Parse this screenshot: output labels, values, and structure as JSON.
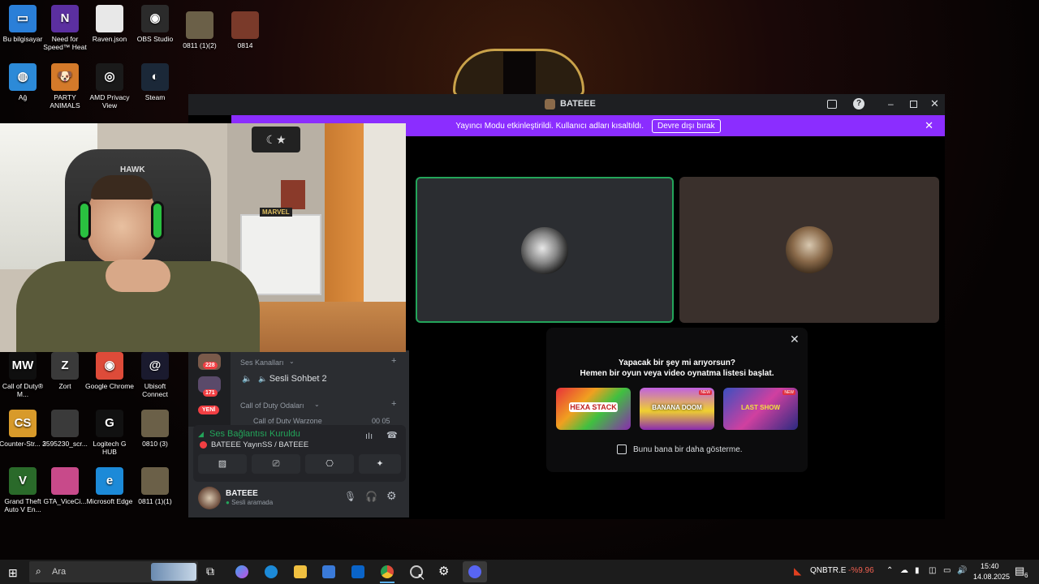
{
  "desktop": {
    "icons": [
      {
        "label": "Bu bilgisayar",
        "color": "#2a7fd8",
        "glyph": "▭"
      },
      {
        "label": "Need for Speed™ Heat",
        "color": "#5b2fa0",
        "glyph": "N"
      },
      {
        "label": "Raven.json",
        "color": "#e8e8e8",
        "glyph": ""
      },
      {
        "label": "OBS Studio",
        "color": "#2b2b2b",
        "glyph": "◉"
      },
      {
        "label": "0811 (1)(2)",
        "color": "#6b6048",
        "glyph": ""
      },
      {
        "label": "0814",
        "color": "#7a3a2a",
        "glyph": ""
      },
      {
        "label": "Ağ",
        "color": "#2c8ad8",
        "glyph": "◍"
      },
      {
        "label": "PARTY ANIMALS",
        "color": "#d47a2a",
        "glyph": "🐶"
      },
      {
        "label": "AMD Privacy View",
        "color": "#1a1a1a",
        "glyph": "◎"
      },
      {
        "label": "Steam",
        "color": "#1b2838",
        "glyph": "◐"
      },
      {
        "label": "Call of Duty® M...",
        "color": "#0f0f0f",
        "glyph": "MW"
      },
      {
        "label": "Zort",
        "color": "#3a3a3a",
        "glyph": "Z"
      },
      {
        "label": "Google Chrome",
        "color": "#dd4b39",
        "glyph": "◉"
      },
      {
        "label": "Ubisoft Connect",
        "color": "#1a1a2e",
        "glyph": "@"
      },
      {
        "label": "Counter-Str... 2",
        "color": "#d89a2a",
        "glyph": "CS"
      },
      {
        "label": "3595230_scr...",
        "color": "#3a3a3a",
        "glyph": ""
      },
      {
        "label": "Logitech G HUB",
        "color": "#111",
        "glyph": "G"
      },
      {
        "label": "0810 (3)",
        "color": "#6b6048",
        "glyph": ""
      },
      {
        "label": "Grand Theft Auto V En...",
        "color": "#2a6a2a",
        "glyph": "V"
      },
      {
        "label": "GTA_ViceCi...",
        "color": "#c84a8a",
        "glyph": ""
      },
      {
        "label": "Microsoft Edge",
        "color": "#1c8ad8",
        "glyph": "e"
      },
      {
        "label": "0811 (1)(1)",
        "color": "#6b6048",
        "glyph": ""
      }
    ]
  },
  "discord": {
    "window_title": "BATEEE",
    "banner_text": "Yayıncı Modu etkinleştirildi. Kullanıcı adları kısaltıldı.",
    "banner_button": "Devre dışı bırak",
    "popup": {
      "title": "Yapacak bir şey mi arıyorsun?",
      "subtitle": "Hemen bir oyun veya video oynatma listesi başlat.",
      "activities": [
        "HEXA STACK",
        "BANANA DOOM",
        "LAST SHOW"
      ],
      "activity_badge": "NEW",
      "checkbox_label": "Bunu bana bir daha gösterme."
    },
    "sidebar": {
      "server_badges": [
        "228",
        "171"
      ],
      "new_badge": "YENİ",
      "category1": "Ses Kanalları",
      "channel1": "Sesli Sohbet 2",
      "category2": "Call of Duty Odaları",
      "channel2": "Call of Duty Warzone",
      "channel2_counts": "00 05"
    },
    "voice_status": {
      "title": "Ses Bağlantısı Kuruldu",
      "subtitle": "BATEEE YayınSS / BATEEE"
    },
    "user": {
      "name": "BATEEE",
      "status": "Sesli aramada"
    }
  },
  "webcam": {
    "chair_text": "HAWK",
    "sign_text": "MARVEL"
  },
  "taskbar": {
    "search_placeholder": "Ara",
    "stock_symbol": "QNBTR.E",
    "stock_change": "-%9.96",
    "time": "15:40",
    "date": "14.08.2025",
    "notif_count": "6"
  }
}
